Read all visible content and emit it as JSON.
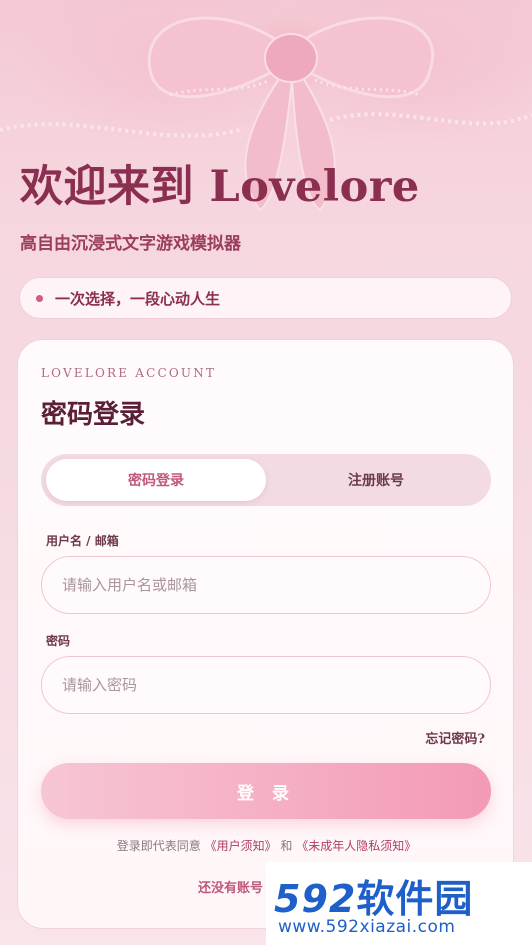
{
  "hero": {
    "title": "欢迎来到 Lovelore",
    "subtitle": "高自由沉浸式文字游戏模拟器",
    "slogan": "一次选择，一段心动人生"
  },
  "card": {
    "eyebrow": "LOVELORE ACCOUNT",
    "title": "密码登录",
    "tabs": [
      {
        "label": "密码登录",
        "active": true
      },
      {
        "label": "注册账号",
        "active": false
      }
    ],
    "username": {
      "label": "用户名 / 邮箱",
      "placeholder": "请输入用户名或邮箱",
      "value": ""
    },
    "password": {
      "label": "密码",
      "placeholder": "请输入密码",
      "value": ""
    },
    "forgot": "忘记密码?",
    "login_button": "登 录",
    "terms": {
      "prefix": "登录即代表同意",
      "user_terms": "《用户须知》",
      "and": "和",
      "minor_privacy": "《未成年人隐私须知》"
    },
    "register_prompt": "还没有账号"
  },
  "watermark": {
    "brand_number": "592",
    "brand_text": "软件园",
    "url": "www.592xiazai.com"
  },
  "colors": {
    "accent": "#c0587c",
    "title": "#8a2f4f",
    "button_start": "#f7c6d3",
    "button_end": "#f39ab5"
  }
}
